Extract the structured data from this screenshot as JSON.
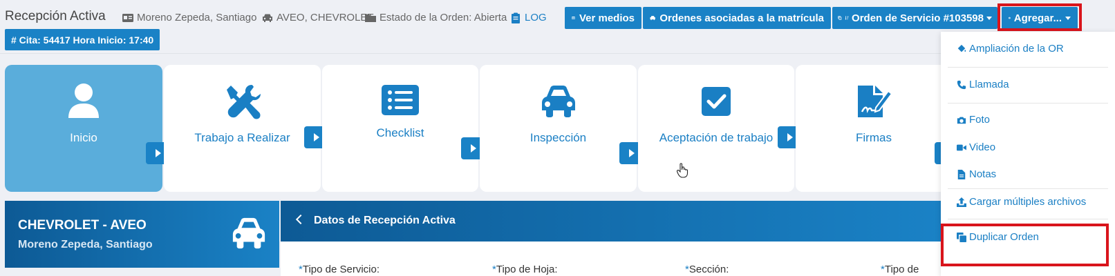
{
  "header": {
    "title": "Recepción Activa",
    "client": "Moreno Zepeda, Santiago",
    "vehicle": "AVEO, CHEVROLET",
    "order_status": "Estado de la Orden: Abierta",
    "log": "LOG",
    "cita": "# Cita: 54417 Hora Inicio: 17:40"
  },
  "toolbar": {
    "ver_medios": "Ver medios",
    "ordenes_asociadas": "Ordenes asociadas a la matrícula",
    "orden_servicio": "Orden de Servicio #103598",
    "agregar": "Agregar..."
  },
  "steps": [
    {
      "label": "Inicio",
      "icon": "user-icon",
      "active": true
    },
    {
      "label": "Trabajo a Realizar",
      "icon": "tools-icon"
    },
    {
      "label": "Checklist",
      "icon": "list-icon"
    },
    {
      "label": "Inspección",
      "icon": "car-icon"
    },
    {
      "label": "Aceptación de trabajo",
      "icon": "check-square-icon"
    },
    {
      "label": "Firmas",
      "icon": "signature-icon"
    }
  ],
  "vehicle_panel": {
    "make_model": "CHEVROLET - AVEO",
    "owner": "Moreno Zepeda, Santiago"
  },
  "datos": {
    "title": "Datos de Recepción Activa",
    "fields": [
      {
        "required": "*",
        "label": "Tipo de Servicio:"
      },
      {
        "required": "*",
        "label": "Tipo de Hoja:"
      },
      {
        "required": "*",
        "label": "Sección:"
      },
      {
        "required": "*",
        "label": "Tipo de Cliente:"
      }
    ]
  },
  "menu": {
    "items": [
      {
        "label": "Ampliación de la OR",
        "icon": "fill-drip-icon"
      },
      {
        "label": "Llamada",
        "icon": "phone-icon"
      },
      {
        "label": "Foto",
        "icon": "camera-icon"
      },
      {
        "label": "Video",
        "icon": "video-icon"
      },
      {
        "label": "Notas",
        "icon": "file-icon"
      },
      {
        "label": "Cargar múltiples archivos",
        "icon": "upload-icon"
      },
      {
        "label": "Duplicar Orden",
        "icon": "copy-icon"
      }
    ]
  },
  "colors": {
    "primary": "#1a82c6",
    "active_step": "#5aaddb",
    "highlight": "#d9141b"
  }
}
